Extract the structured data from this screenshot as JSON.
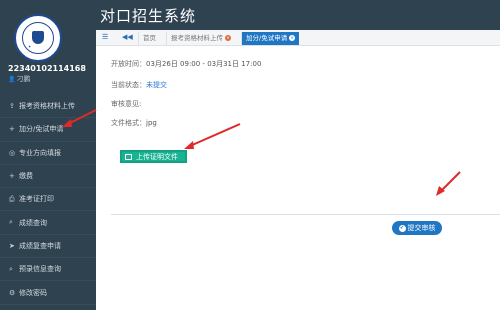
{
  "app": {
    "title": "对口招生系统"
  },
  "user": {
    "id": "22340102114168",
    "name": "刁鹏"
  },
  "sidebar": {
    "items": [
      {
        "label": "报考资格材料上传",
        "icon": "upload-icon"
      },
      {
        "label": "加分/免试申请",
        "icon": "plus-icon"
      },
      {
        "label": "专业方向填报",
        "icon": "target-icon"
      },
      {
        "label": "缴费",
        "icon": "plus-icon"
      },
      {
        "label": "准考证打印",
        "icon": "printer-icon"
      },
      {
        "label": "成绩查询",
        "icon": "search-icon"
      },
      {
        "label": "成绩复查申请",
        "icon": "send-icon"
      },
      {
        "label": "预录信息查询",
        "icon": "search-icon"
      },
      {
        "label": "修改密码",
        "icon": "settings-icon"
      }
    ]
  },
  "tabs": {
    "items": [
      {
        "label": "首页",
        "active": false
      },
      {
        "label": "报考资格材料上传",
        "active": false
      },
      {
        "label": "加分/免试申请",
        "active": true
      }
    ]
  },
  "form": {
    "open_label": "开放时间：",
    "open_value": "03月26日 09:00 - 03月31日 17:00",
    "status_label": "当前状态：",
    "status_value": "未提交",
    "review_label": "审核意见:",
    "format_label": "文件格式：",
    "format_value": "jpg",
    "upload_label": "上传证明文件",
    "submit_label": "提交审核"
  },
  "colors": {
    "sidebar_bg": "#2f4250",
    "accent_blue": "#1f77c4",
    "upload_green": "#19b292",
    "annotation_red": "#e02a2a"
  }
}
